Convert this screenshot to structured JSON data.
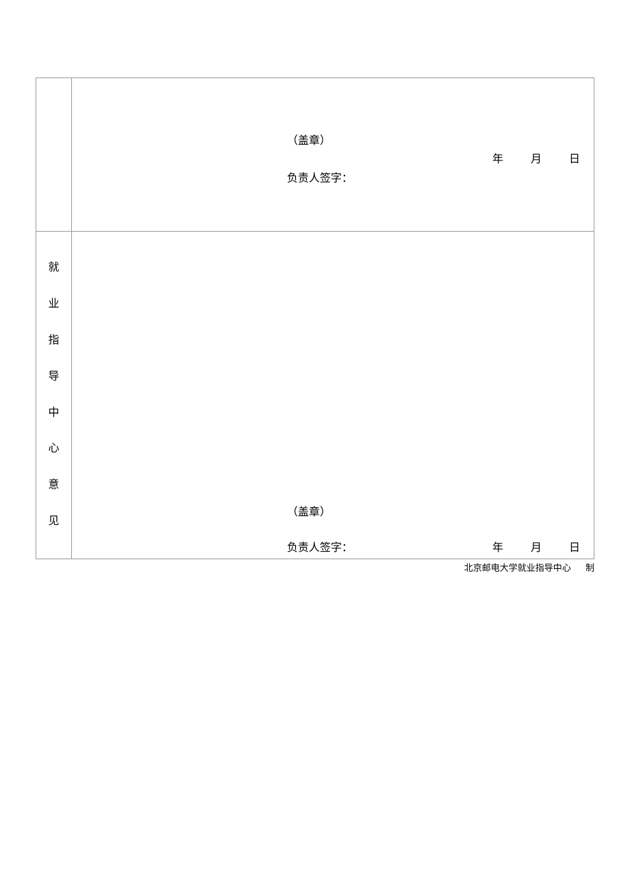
{
  "rows": [
    {
      "label": "",
      "stamp": "（盖章）",
      "signature": "负责人签字：",
      "date_year": "年",
      "date_month": "月",
      "date_day": "日"
    },
    {
      "label": "就业指导中心意见",
      "stamp": "（盖章）",
      "signature": "负责人签字：",
      "date_year": "年",
      "date_month": "月",
      "date_day": "日"
    }
  ],
  "footer": {
    "organization": "北京邮电大学就业指导中心",
    "suffix": "制"
  }
}
